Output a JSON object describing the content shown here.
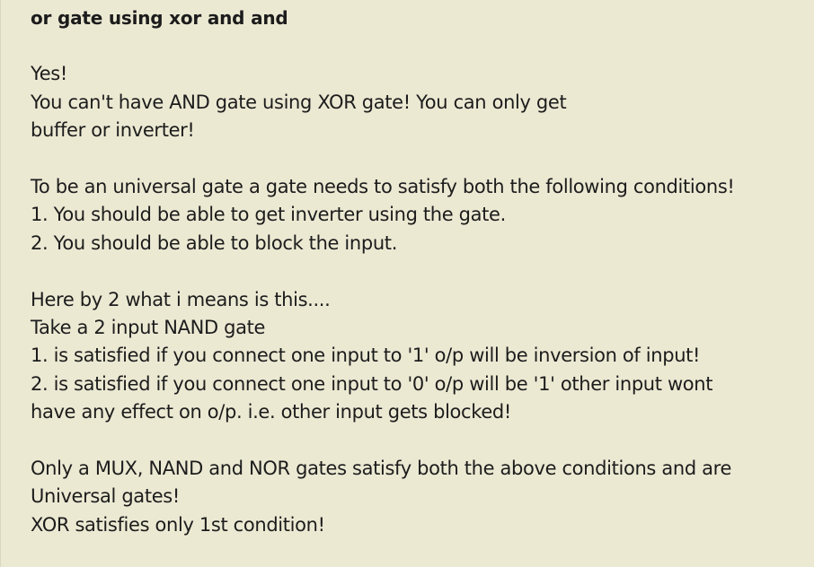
{
  "post": {
    "title": "or gate using xor and and",
    "paragraphs": [
      [
        "Yes!",
        "You can't have AND gate using XOR gate! You can only get",
        "buffer or inverter!"
      ],
      [
        "To be an universal gate a gate needs to satisfy both the following conditions!",
        "1. You should be able to get inverter using the gate.",
        "2. You should be able to block the input."
      ],
      [
        "Here by 2 what i means is this....",
        "Take a 2 input NAND gate",
        "1. is satisfied if you connect one input to '1' o/p will be inversion of input!",
        "2. is satisfied if you connect one input to '0' o/p will be '1' other input wont",
        "have any effect on o/p. i.e. other input gets blocked!"
      ],
      [
        "Only a MUX, NAND and NOR gates satisfy both the above conditions and are",
        "Universal gates!",
        "XOR satisfies only 1st condition!"
      ]
    ]
  }
}
